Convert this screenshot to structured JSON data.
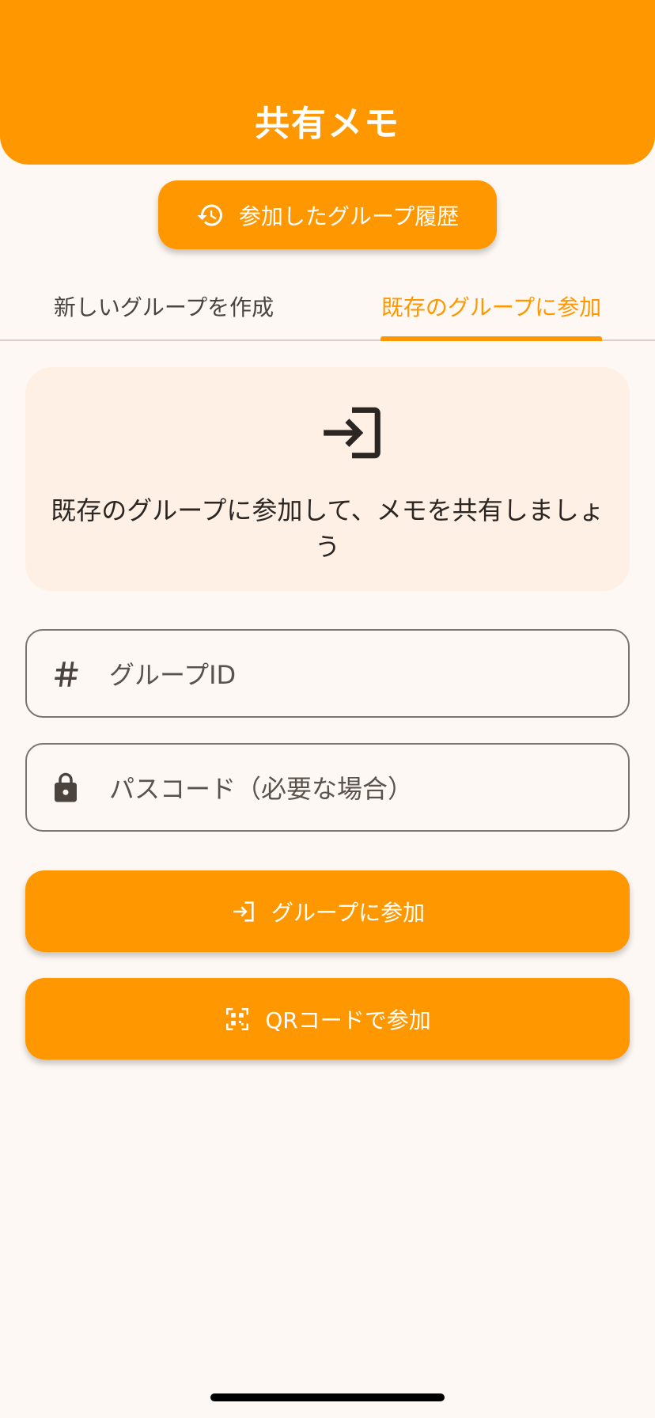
{
  "app_bar": {
    "title": "共有メモ"
  },
  "history_button": {
    "label": "参加したグループ履歴",
    "icon": "history-icon"
  },
  "tabs": [
    {
      "label": "新しいグループを作成",
      "selected": false
    },
    {
      "label": "既存のグループに参加",
      "selected": true
    }
  ],
  "info_card": {
    "icon": "login-icon",
    "text": "既存のグループに参加して、メモを共有しましょう"
  },
  "fields": {
    "group_id": {
      "placeholder": "グループID",
      "value": "",
      "icon": "hash-icon"
    },
    "passcode": {
      "placeholder": "パスコード（必要な場合）",
      "value": "",
      "icon": "lock-icon"
    }
  },
  "buttons": {
    "join": {
      "label": "グループに参加",
      "icon": "login-icon"
    },
    "qr": {
      "label": "QRコードで参加",
      "icon": "qr-scan-icon"
    }
  },
  "colors": {
    "primary": "#ff9800",
    "background": "#fdf8f4",
    "card": "#fff0e6",
    "on_primary": "#ffffff",
    "text": "#2b2622",
    "outline": "#7d746e"
  }
}
